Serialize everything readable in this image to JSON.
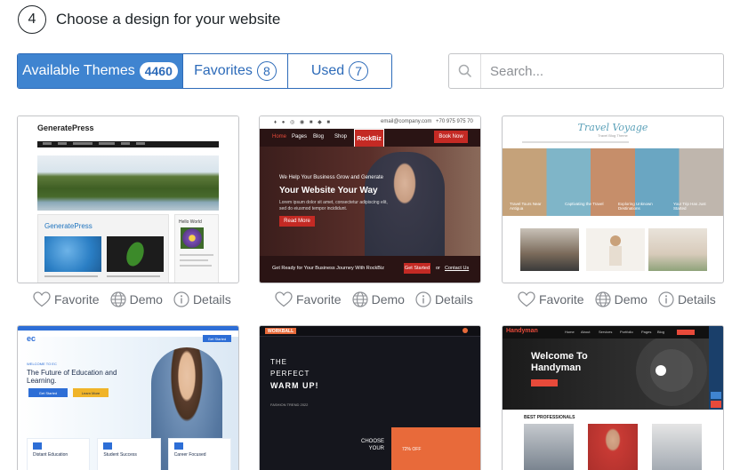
{
  "step": {
    "number": "4",
    "title": "Choose a design for your website"
  },
  "tabs": [
    {
      "label": "Available Themes",
      "count": "4460",
      "active": true
    },
    {
      "label": "Favorites",
      "count": "8",
      "active": false
    },
    {
      "label": "Used",
      "count": "7",
      "active": false
    }
  ],
  "search": {
    "placeholder": "Search..."
  },
  "card_actions": {
    "favorite": "Favorite",
    "demo": "Demo",
    "details": "Details"
  },
  "themes": [
    {
      "thumb_title": "GeneratePress",
      "content_title": "GeneratePress",
      "side_title": "Hello World"
    },
    {
      "topbar_email": "email@company.com",
      "topbar_phone": "+70 975 975 70",
      "brand": "RockBiz",
      "cta_nav": "Book Now",
      "kicker": "We Help Your Business Grow and Generate",
      "headline": "Your Website Your Way",
      "body": "Lorem ipsum dolor sit amet, consectetur adipiscing elit, sed do eiusmod tempor incididunt.",
      "button": "Read More",
      "footer_text": "Get Ready for Your Business Journey With RockBiz",
      "footer_btn": "Get Started",
      "footer_or": "or",
      "footer_link": "Contact Us",
      "nav_items": [
        "Home",
        "Pages",
        "Blog",
        "Shop"
      ]
    },
    {
      "brand": "Travel Voyage",
      "tagline": "Travel Blog Theme",
      "captions": [
        "Travel Tours Near Antigua",
        "Captivating the Travel",
        "Exploring Unknown Destinations",
        "",
        "Your Trip Has Just Started"
      ]
    },
    {
      "logo": "ec",
      "kicker": "WELCOME TO EC",
      "headline": "The Future of Education and Learning.",
      "btn_primary": "Get Started",
      "btn_secondary": "Learn More",
      "nav_button": "Get Started",
      "features": [
        "Distant Education",
        "Student Success",
        "Career Focused"
      ]
    },
    {
      "brand": "WORKBALL",
      "line1": "THE",
      "line2": "PERFECT",
      "line3": "WARM UP!",
      "small": "FASHION TREND 2022",
      "choose1": "CHOOSE",
      "choose2": "YOUR",
      "discount": "72% OFF"
    },
    {
      "brand": "Handyman",
      "headline1": "Welcome To",
      "headline2": "Handyman",
      "section": "BEST PROFESSIONALS",
      "nav_items": [
        "Home",
        "About",
        "Services",
        "Portfolio",
        "Pages",
        "Blog",
        "Contact"
      ]
    }
  ]
}
